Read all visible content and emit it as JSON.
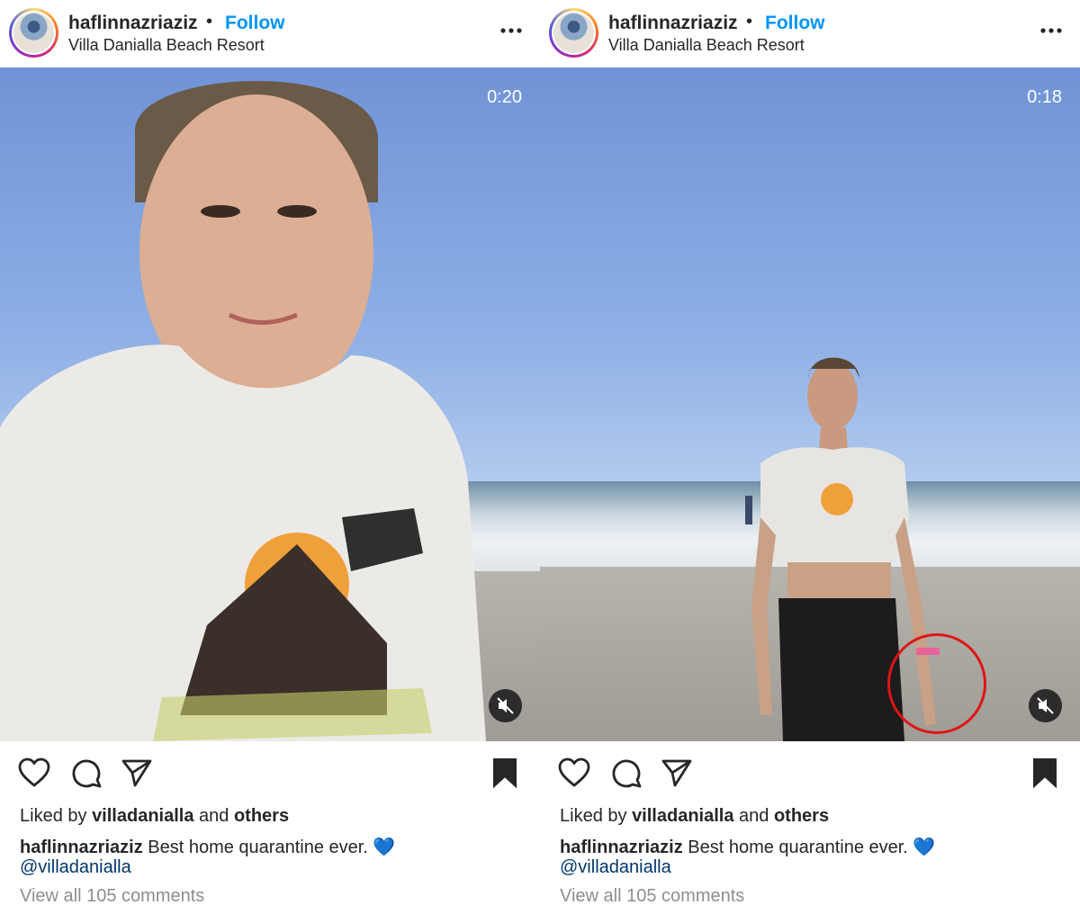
{
  "posts": [
    {
      "username": "haflinnazriaziz",
      "separator": "•",
      "follow_label": "Follow",
      "location": "Villa Danialla Beach Resort",
      "video_time": "0:20",
      "liked_prefix": "Liked by",
      "liked_user": "villadanialla",
      "liked_and": "and",
      "liked_others": "others",
      "caption_user": "haflinnazriaziz",
      "caption_text": "Best home quarantine ever. 💙",
      "mention": "@villadanialla",
      "view_comments": "View all 105 comments"
    },
    {
      "username": "haflinnazriaziz",
      "separator": "•",
      "follow_label": "Follow",
      "location": "Villa Danialla Beach Resort",
      "video_time": "0:18",
      "liked_prefix": "Liked by",
      "liked_user": "villadanialla",
      "liked_and": "and",
      "liked_others": "others",
      "caption_user": "haflinnazriaziz",
      "caption_text": "Best home quarantine ever. 💙",
      "mention": "@villadanialla",
      "view_comments": "View all 105 comments"
    }
  ],
  "icons": {
    "more": "more-icon",
    "like": "heart-icon",
    "comment": "comment-icon",
    "share": "send-icon",
    "save": "bookmark-icon",
    "mute": "speaker-muted-icon"
  },
  "colors": {
    "follow_blue": "#0095f6",
    "mention_blue": "#00376b",
    "muted_text": "#8e8e8e",
    "annotation_red": "#e01414"
  }
}
